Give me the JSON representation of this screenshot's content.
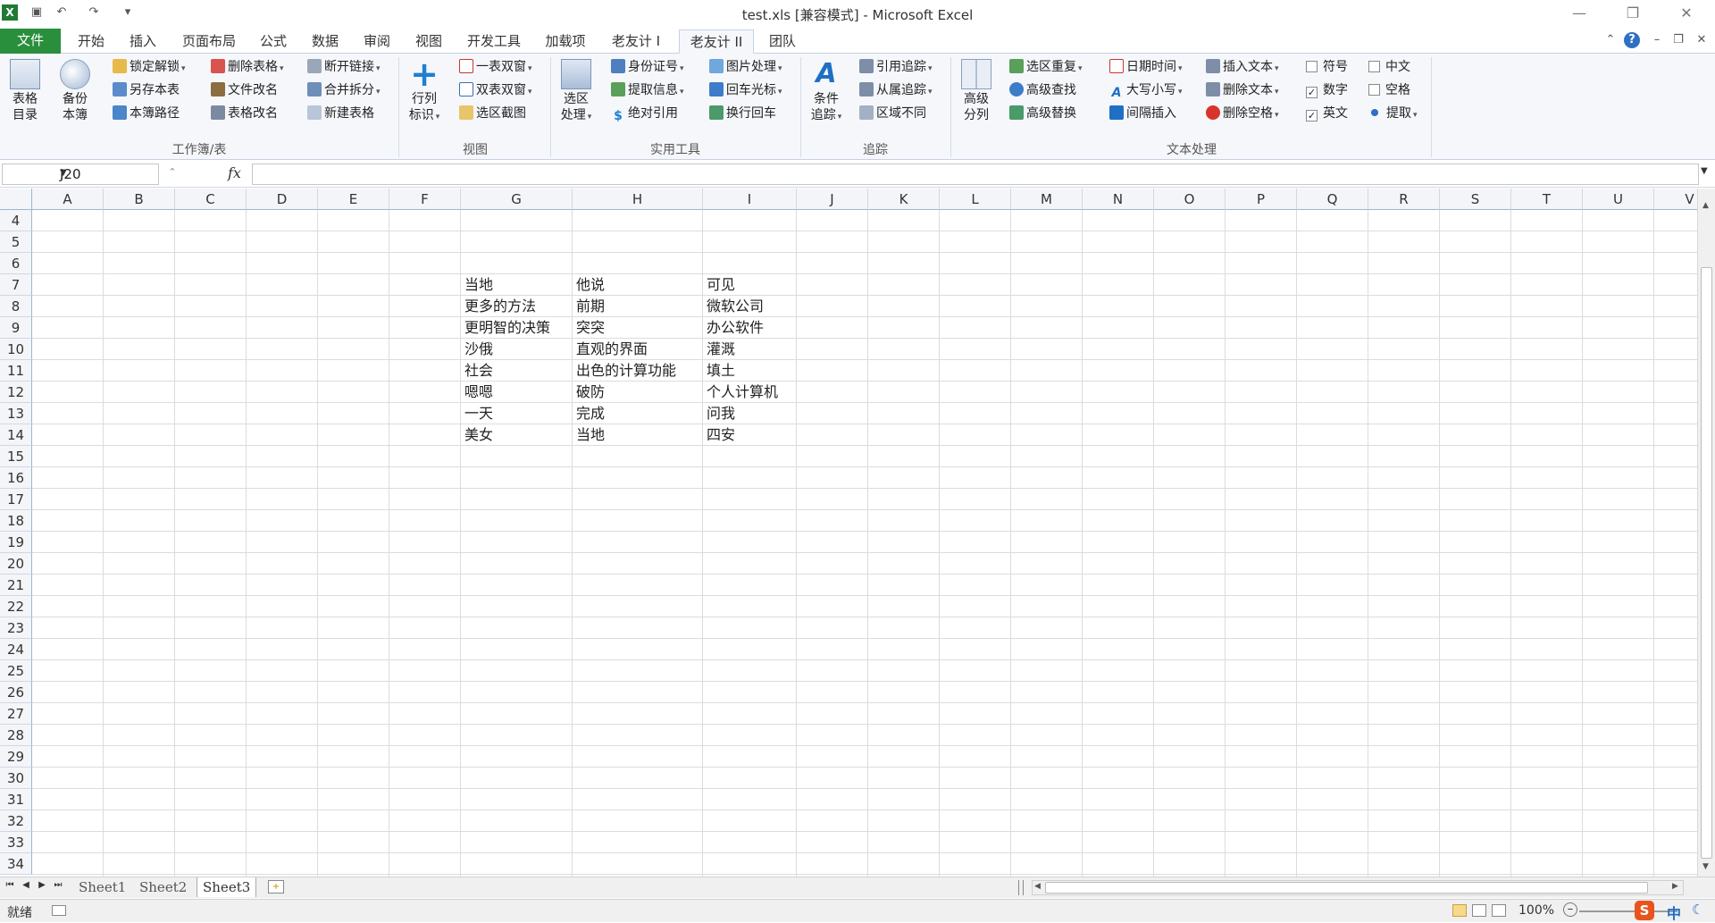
{
  "window": {
    "title": "test.xls  [兼容模式] - Microsoft Excel",
    "controls": [
      "—",
      "❐",
      "✕"
    ]
  },
  "quick_access": {
    "app_icon": "excel-icon",
    "save_icon": "save-icon",
    "undo_icon": "undo-icon",
    "redo_icon": "redo-icon",
    "customize_icon": "customize-icon"
  },
  "tabs": [
    {
      "label": "文件"
    },
    {
      "label": "开始"
    },
    {
      "label": "插入"
    },
    {
      "label": "页面布局"
    },
    {
      "label": "公式"
    },
    {
      "label": "数据"
    },
    {
      "label": "审阅"
    },
    {
      "label": "视图"
    },
    {
      "label": "开发工具"
    },
    {
      "label": "加载项"
    },
    {
      "label": "老友计 I"
    },
    {
      "label": "老友计 II"
    },
    {
      "label": "团队"
    }
  ],
  "active_tab": "老友计 II",
  "ribbon": {
    "groups": [
      {
        "label": "工作簿/表"
      },
      {
        "label": "视图"
      },
      {
        "label": "实用工具"
      },
      {
        "label": "追踪"
      },
      {
        "label": "文本处理"
      }
    ],
    "big_buttons": {
      "table_dir": [
        "表格",
        "目录"
      ],
      "backup": [
        "备份",
        "本簿"
      ],
      "row_col_mark": [
        "行列",
        "标识"
      ],
      "sel_process": [
        "选区",
        "处理"
      ],
      "cond_trace": [
        "条件",
        "追踪"
      ],
      "adv_split": [
        "高级",
        "分列"
      ]
    },
    "small_buttons": {
      "lock_unlock": "锁定解锁",
      "save_sheet": "另存本表",
      "book_path": "本簿路径",
      "delete_table": "删除表格",
      "rename_file": "文件改名",
      "rename_table": "表格改名",
      "break_link": "断开链接",
      "merge_split": "合并拆分",
      "new_table": "新建表格",
      "one_table_two_win": "一表双窗",
      "two_table_two_win": "双表双窗",
      "sel_screenshot": "选区截图",
      "id_number": "身份证号",
      "extract_info": "提取信息",
      "abs_ref": "绝对引用",
      "image_proc": "图片处理",
      "enter_cursor": "回车光标",
      "wrap_enter": "换行回车",
      "ref_trace": "引用追踪",
      "dep_trace": "从属追踪",
      "area_diff": "区域不同",
      "sel_duplicate": "选区重复",
      "adv_find": "高级查找",
      "adv_replace": "高级替换",
      "date_time": "日期时间",
      "upper_lower": "大写小写",
      "interval_insert": "间隔插入",
      "insert_text": "插入文本",
      "delete_text": "删除文本",
      "delete_space": "删除空格",
      "extract": "提取"
    },
    "checkboxes": {
      "symbol": {
        "label": "符号",
        "checked": false
      },
      "chinese": {
        "label": "中文",
        "checked": false
      },
      "number": {
        "label": "数字",
        "checked": true
      },
      "space": {
        "label": "空格",
        "checked": false
      },
      "english": {
        "label": "英文",
        "checked": true
      }
    }
  },
  "formula_bar": {
    "name_box": "J20",
    "fx": "fx",
    "value": ""
  },
  "grid": {
    "columns": [
      "A",
      "B",
      "C",
      "D",
      "E",
      "F",
      "G",
      "H",
      "I",
      "J",
      "K",
      "L",
      "M",
      "N",
      "O",
      "P",
      "Q",
      "R",
      "S",
      "T",
      "U",
      "V"
    ],
    "rows": [
      "4",
      "5",
      "6",
      "7",
      "8",
      "9",
      "10",
      "11",
      "12",
      "13",
      "14",
      "15",
      "16",
      "17",
      "18",
      "19",
      "20",
      "21",
      "22",
      "23",
      "24",
      "25",
      "26",
      "27",
      "28",
      "29",
      "30",
      "31",
      "32",
      "33",
      "34"
    ],
    "cells": [
      {
        "ref": "G7",
        "value": "当地"
      },
      {
        "ref": "H7",
        "value": "他说"
      },
      {
        "ref": "I7",
        "value": "可见"
      },
      {
        "ref": "G8",
        "value": "更多的方法"
      },
      {
        "ref": "H8",
        "value": "前期"
      },
      {
        "ref": "I8",
        "value": "微软公司"
      },
      {
        "ref": "G9",
        "value": "更明智的决策"
      },
      {
        "ref": "H9",
        "value": "突突"
      },
      {
        "ref": "I9",
        "value": "办公软件"
      },
      {
        "ref": "G10",
        "value": "沙俄"
      },
      {
        "ref": "H10",
        "value": "直观的界面"
      },
      {
        "ref": "I10",
        "value": "灌溉"
      },
      {
        "ref": "G11",
        "value": "社会"
      },
      {
        "ref": "H11",
        "value": "出色的计算功能"
      },
      {
        "ref": "I11",
        "value": "填土"
      },
      {
        "ref": "G12",
        "value": "嗯嗯"
      },
      {
        "ref": "H12",
        "value": "破防"
      },
      {
        "ref": "I12",
        "value": "个人计算机"
      },
      {
        "ref": "G13",
        "value": "一天"
      },
      {
        "ref": "H13",
        "value": "完成"
      },
      {
        "ref": "I13",
        "value": "问我"
      },
      {
        "ref": "G14",
        "value": "美女"
      },
      {
        "ref": "H14",
        "value": "当地"
      },
      {
        "ref": "I14",
        "value": "四安"
      }
    ]
  },
  "sheets": [
    {
      "name": "Sheet1",
      "active": false
    },
    {
      "name": "Sheet2",
      "active": false
    },
    {
      "name": "Sheet3",
      "active": true
    }
  ],
  "status": {
    "ready": "就绪",
    "zoom": "100%",
    "ime": "中"
  }
}
